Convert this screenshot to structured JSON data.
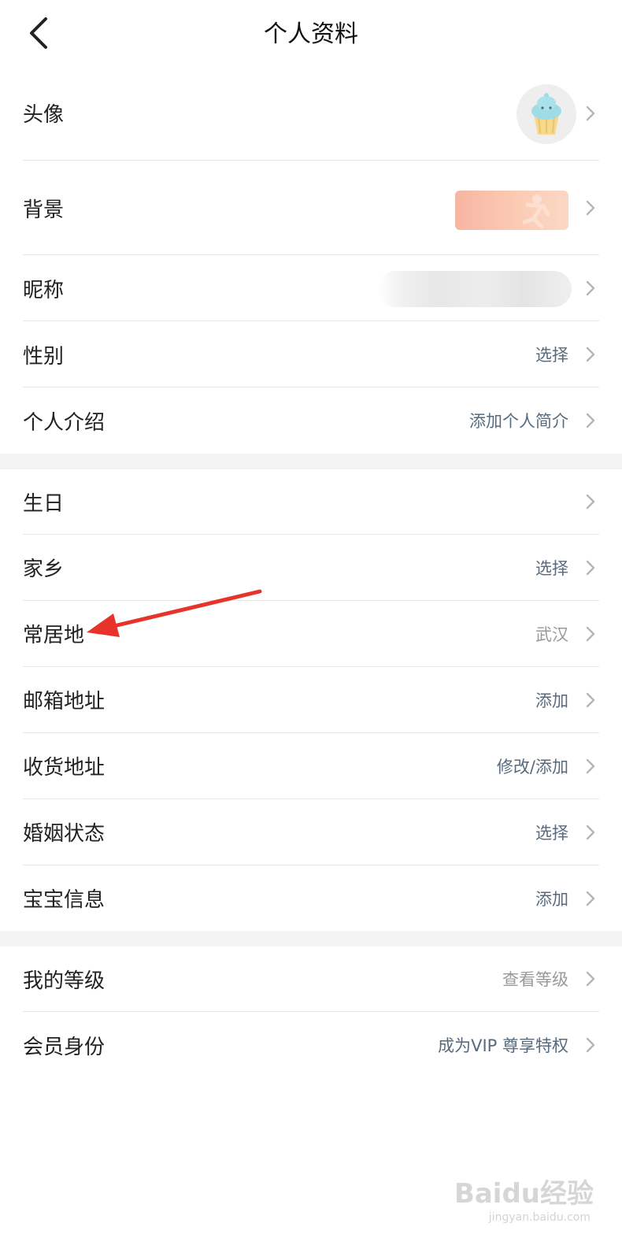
{
  "header": {
    "title": "个人资料"
  },
  "section1": {
    "avatar": {
      "label": "头像"
    },
    "background": {
      "label": "背景"
    },
    "nickname": {
      "label": "昵称"
    },
    "gender": {
      "label": "性别",
      "value": "选择"
    },
    "intro": {
      "label": "个人介绍",
      "value": "添加个人简介"
    }
  },
  "section2": {
    "birthday": {
      "label": "生日"
    },
    "hometown": {
      "label": "家乡",
      "value": "选择"
    },
    "residence": {
      "label": "常居地",
      "value": "武汉"
    },
    "email": {
      "label": "邮箱地址",
      "value": "添加"
    },
    "shipping": {
      "label": "收货地址",
      "value": "修改/添加"
    },
    "marital": {
      "label": "婚姻状态",
      "value": "选择"
    },
    "baby": {
      "label": "宝宝信息",
      "value": "添加"
    }
  },
  "section3": {
    "level": {
      "label": "我的等级",
      "value": "查看等级"
    },
    "member": {
      "label": "会员身份",
      "value": "成为VIP 尊享特权"
    }
  },
  "watermark": {
    "logo": "Baidu经验",
    "url": "jingyan.baidu.com"
  },
  "colors": {
    "link": "#586a7e",
    "muted": "#999999",
    "arrow": "#e8332a"
  }
}
